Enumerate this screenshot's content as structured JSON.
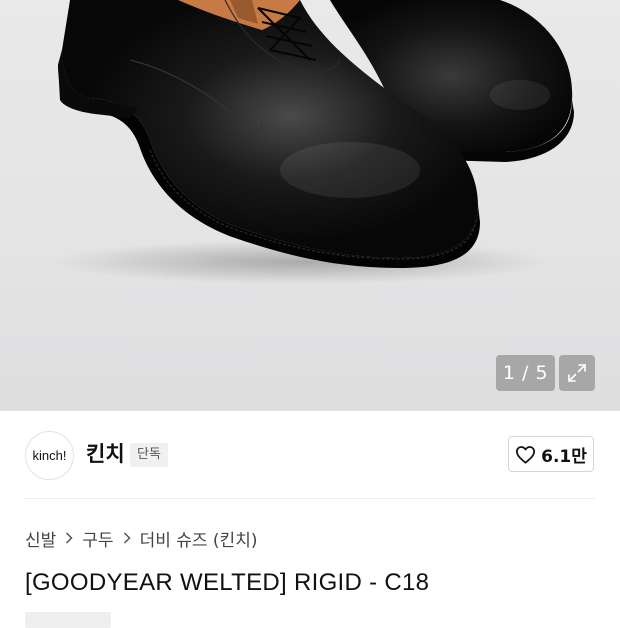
{
  "image_viewer": {
    "counter_text": "1 / 5",
    "background_color": "#e6e6e7",
    "shoe_color": "#0d0d0d",
    "lining_color": "#c87a45"
  },
  "brand": {
    "logo_text": "kinch!",
    "name": "킨치",
    "badge": "단독"
  },
  "like": {
    "count": "6.1만"
  },
  "breadcrumb": {
    "items": [
      "신발",
      "구두",
      "더비 슈즈 (킨치)"
    ]
  },
  "product": {
    "title": "[GOODYEAR WELTED] RIGID - C18"
  }
}
